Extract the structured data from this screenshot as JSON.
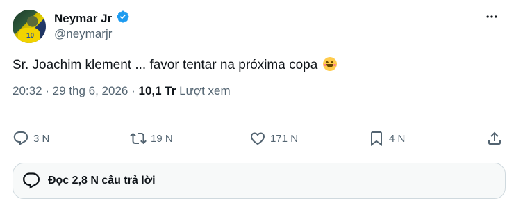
{
  "author": {
    "name": "Neymar Jr",
    "handle": "@neymarjr",
    "avatar_number": "10",
    "verified": true
  },
  "tweet": {
    "text": "Sr. Joachim klement ... favor tentar na próxima copa",
    "emoji": "blush-emoji"
  },
  "meta": {
    "time": "20:32",
    "sep1": " · ",
    "date": "29 thg 6, 2026",
    "sep2": " · ",
    "views_count": "10,1 Tr",
    "views_label": " Lượt xem"
  },
  "actions": {
    "replies": "3 N",
    "retweets": "19 N",
    "likes": "171 N",
    "bookmarks": "4 N"
  },
  "read_replies": {
    "label": "Đọc 2,8 N câu trả lời"
  },
  "colors": {
    "verified_blue": "#1d9bf0",
    "secondary_text": "#536471",
    "primary_text": "#0f1419"
  }
}
